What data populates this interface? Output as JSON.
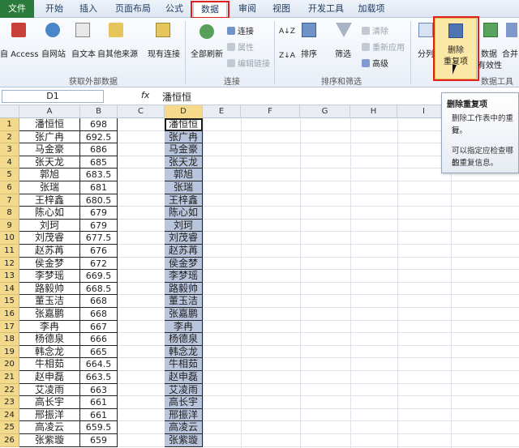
{
  "tabs": [
    "文件",
    "开始",
    "插入",
    "页面布局",
    "公式",
    "数据",
    "审阅",
    "视图",
    "开发工具",
    "加载项"
  ],
  "ribbon": {
    "group_external": "获取外部数据",
    "group_connections": "连接",
    "group_sort_filter": "排序和筛选",
    "group_data_tools": "数据工具",
    "btn_access": "自 Access",
    "btn_web": "自网站",
    "btn_text": "自文本",
    "btn_other": "自其他来源",
    "btn_existing": "现有连接",
    "btn_refresh": "全部刷新",
    "conn_link": "连接",
    "conn_prop": "属性",
    "conn_edit": "编辑链接",
    "sort_az": "A↓Z",
    "sort_za": "Z↓A",
    "btn_sort": "排序",
    "btn_filter": "筛选",
    "flt_clear": "清除",
    "flt_reapply": "重新应用",
    "flt_advanced": "高级",
    "btn_split": "分列",
    "btn_remove_dup_1": "删除",
    "btn_remove_dup_2": "重复项",
    "btn_validation": "数据",
    "btn_validation_2": "有效性",
    "btn_merge": "合并"
  },
  "formula_bar": {
    "name_box": "D1",
    "fx": "fx",
    "value": "潘恒恒"
  },
  "columns": [
    "A",
    "B",
    "C",
    "D",
    "E",
    "F",
    "G",
    "H",
    "I"
  ],
  "rows": [
    {
      "n": "1",
      "name": "潘恒恒",
      "score": "698"
    },
    {
      "n": "2",
      "name": "张广冉",
      "score": "692.5"
    },
    {
      "n": "3",
      "name": "马金豪",
      "score": "686"
    },
    {
      "n": "4",
      "name": "张天龙",
      "score": "685"
    },
    {
      "n": "5",
      "name": "郭旭",
      "score": "683.5"
    },
    {
      "n": "6",
      "name": "张瑞",
      "score": "681"
    },
    {
      "n": "7",
      "name": "王梓鑫",
      "score": "680.5"
    },
    {
      "n": "8",
      "name": "陈心如",
      "score": "679"
    },
    {
      "n": "9",
      "name": "刘珂",
      "score": "679"
    },
    {
      "n": "10",
      "name": "刘茂睿",
      "score": "677.5"
    },
    {
      "n": "11",
      "name": "赵苏苒",
      "score": "676"
    },
    {
      "n": "12",
      "name": "侯金梦",
      "score": "672"
    },
    {
      "n": "13",
      "name": "李梦瑶",
      "score": "669.5"
    },
    {
      "n": "14",
      "name": "路毅帅",
      "score": "668.5"
    },
    {
      "n": "15",
      "name": "董玉洁",
      "score": "668"
    },
    {
      "n": "16",
      "name": "张嘉鹏",
      "score": "668"
    },
    {
      "n": "17",
      "name": "李冉",
      "score": "667"
    },
    {
      "n": "18",
      "name": "杨德泉",
      "score": "666"
    },
    {
      "n": "19",
      "name": "韩念龙",
      "score": "665"
    },
    {
      "n": "20",
      "name": "牛相茹",
      "score": "664.5"
    },
    {
      "n": "21",
      "name": "赵申磊",
      "score": "663.5"
    },
    {
      "n": "22",
      "name": "艾凌雨",
      "score": "663"
    },
    {
      "n": "23",
      "name": "高长宇",
      "score": "661"
    },
    {
      "n": "24",
      "name": "邢振洋",
      "score": "661"
    },
    {
      "n": "25",
      "name": "高凌云",
      "score": "659.5"
    },
    {
      "n": "26",
      "name": "张紫璇",
      "score": "659"
    }
  ],
  "tooltip": {
    "title": "删除重复项",
    "line1": "删除工作表中的重复",
    "line2": "行。",
    "line3": "可以指定应检查哪些",
    "line4": "的重复信息。"
  }
}
